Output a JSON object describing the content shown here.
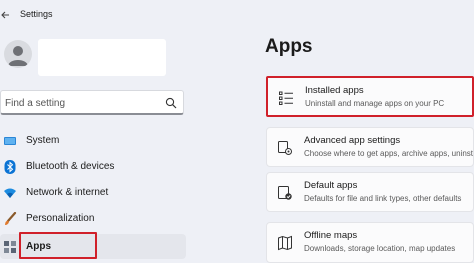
{
  "window": {
    "title": "Settings"
  },
  "sidebar": {
    "search": {
      "placeholder": "Find a setting"
    },
    "items": [
      {
        "label": "System",
        "icon": "system-display-icon",
        "selected": false
      },
      {
        "label": "Bluetooth & devices",
        "icon": "bluetooth-icon",
        "selected": false
      },
      {
        "label": "Network & internet",
        "icon": "wifi-icon",
        "selected": false
      },
      {
        "label": "Personalization",
        "icon": "brush-icon",
        "selected": false
      },
      {
        "label": "Apps",
        "icon": "apps-icon",
        "selected": true
      }
    ]
  },
  "main": {
    "title": "Apps",
    "cards": [
      {
        "title": "Installed apps",
        "subtitle": "Uninstall and manage apps on your PC",
        "icon": "installed-apps-list-icon",
        "highlighted": true
      },
      {
        "title": "Advanced app settings",
        "subtitle": "Choose where to get apps, archive apps, uninst",
        "icon": "advanced-app-settings-icon",
        "highlighted": false
      },
      {
        "title": "Default apps",
        "subtitle": "Defaults for file and link types, other defaults",
        "icon": "default-apps-icon",
        "highlighted": false
      },
      {
        "title": "Offline maps",
        "subtitle": "Downloads, storage location, map updates",
        "icon": "offline-maps-icon",
        "highlighted": false
      }
    ]
  },
  "colors": {
    "background": "#eef0f6",
    "card": "#fbfbfc",
    "highlight_border": "#d0202a",
    "accent_blue": "#0067c0",
    "selected_nav": "#e4e6ec"
  }
}
